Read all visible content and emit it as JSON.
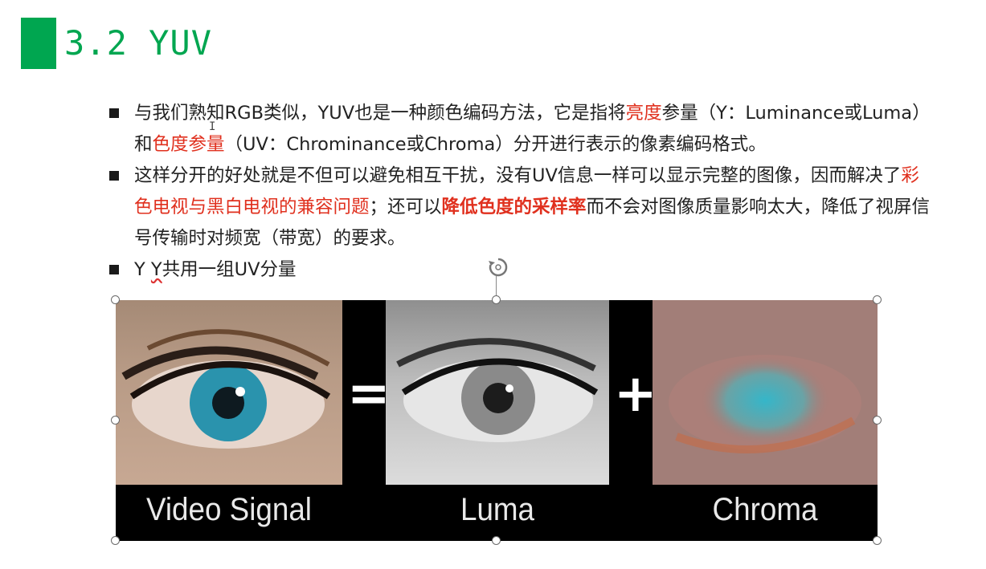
{
  "slide": {
    "title": "3.2 YUV",
    "bullet1": {
      "t1": "与我们熟知RGB类似，YUV也是一种颜色编码方法，它是指将",
      "h1": "亮度",
      "t2": "参量（Y：Luminance或Luma）和",
      "h2": "色度参量",
      "t3": "（UV：Chrominance或Chroma）分开进行表示的像素编码格式。"
    },
    "bullet2": {
      "t1": "这样分开的好处就是不但可以避免相互干扰，没有UV信息一样可以显示完整的图像，因而解决了",
      "h1": "彩色电视与黑白电视的兼容问题",
      "t2": "；还可以",
      "h2": "降低色度的采样率",
      "t3": "而不会对图像质量影响太大，降低了视屏信号传输时对频宽（带宽）的要求。"
    },
    "bullet3": {
      "t1": "Y ",
      "t2": "Y",
      "t3": "共用一组UV分量"
    },
    "image": {
      "eq_sign": "=",
      "plus_sign": "+",
      "caption1": "Video Signal",
      "caption2": "Luma",
      "caption3": "Chroma"
    }
  },
  "colors": {
    "accent_green": "#00a650",
    "highlight_red": "#e0301e"
  },
  "icons": {
    "rotate": "rotate-handle-icon",
    "bullet": "square-bullet-icon"
  }
}
